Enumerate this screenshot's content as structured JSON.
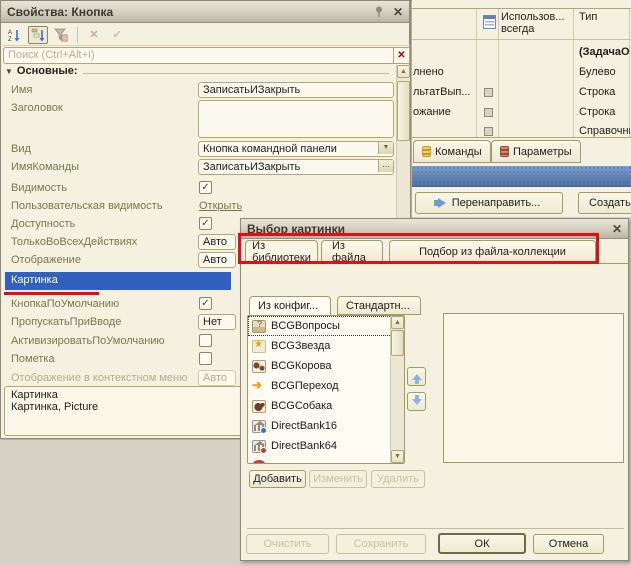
{
  "icons": {
    "check": "✓",
    "close": "✕",
    "dropdown": "▼",
    "up_arrow": "▲",
    "down_arrow": "▼",
    "ellipsis": "...",
    "sort_az": "ЯA↓",
    "toolbar_x": "✕",
    "toolbar_check": "✔",
    "search_clear": "✕"
  },
  "properties_panel": {
    "title": "Свойства: Кнопка",
    "search_placeholder": "Поиск (Ctrl+Alt+I)",
    "section": "Основные:",
    "rows": [
      {
        "label": "Имя",
        "value": "ЗаписатьИЗакрыть"
      },
      {
        "label": "Заголовок",
        "value": ""
      },
      {
        "label": "Вид",
        "value": "Кнопка командной панели"
      },
      {
        "label": "ИмяКоманды",
        "value": "ЗаписатьИЗакрыть"
      },
      {
        "label": "Видимость",
        "checked": true
      },
      {
        "label": "Пользовательская видимость",
        "value": "Открыть"
      },
      {
        "label": "Доступность",
        "checked": true
      },
      {
        "label": "ТолькоВоВсехДействиях",
        "value": "Авто"
      },
      {
        "label": "Отображение",
        "value": "Авто"
      },
      {
        "label": "Картинка",
        "value": ""
      },
      {
        "label": "КнопкаПоУмолчанию",
        "checked": true
      },
      {
        "label": "ПропускатьПриВводе",
        "value": "Нет"
      },
      {
        "label": "АктивизироватьПоУмолчанию",
        "checked": false
      },
      {
        "label": "Пометка",
        "checked": false
      },
      {
        "label": "Отображение в контекстном меню",
        "value": "Авто"
      }
    ],
    "description_line1": "Картинка",
    "description_line2": "Картинка, Picture"
  },
  "background_window": {
    "col_usage_line1": "Использов...",
    "col_usage_line2": "всегда",
    "col_type": "Тип",
    "rows": [
      {
        "name": "",
        "type": "(ЗадачаО"
      },
      {
        "name": "лнено",
        "type": "Булево"
      },
      {
        "name": "льтатВып...",
        "type": "Строка"
      },
      {
        "name": "ожание",
        "type": "Строка"
      },
      {
        "name": "",
        "type": "Справочни"
      }
    ],
    "tab_commands": "Команды",
    "tab_params": "Параметры",
    "btn_redirect": "Перенаправить...",
    "btn_create": "Создать"
  },
  "dialog": {
    "title": "Выбор картинки",
    "tab_library": "Из библиотеки",
    "tab_file": "Из файла",
    "tab_collection": "Подбор из файла-коллекции",
    "subtab_config": "Из конфиг...",
    "subtab_standard": "Стандартн...",
    "list": [
      {
        "label": "BCGВопросы"
      },
      {
        "label": "BCGЗвезда"
      },
      {
        "label": "BCGКорова"
      },
      {
        "label": "BCGПереход"
      },
      {
        "label": "BCGСобака"
      },
      {
        "label": "DirectBank16"
      },
      {
        "label": "DirectBank64"
      }
    ],
    "btn_add": "Добавить",
    "btn_edit": "Изменить",
    "btn_delete": "Удалить",
    "btn_clear": "Очистить",
    "btn_save": "Сохранить",
    "btn_ok": "ОК",
    "btn_cancel": "Отмена"
  },
  "colors": {
    "selection_blue": "#3160c2",
    "annotation_red": "#e01010",
    "panel_cream": "#f5f1e0",
    "titlebar_gray": "#c9c5b6"
  }
}
